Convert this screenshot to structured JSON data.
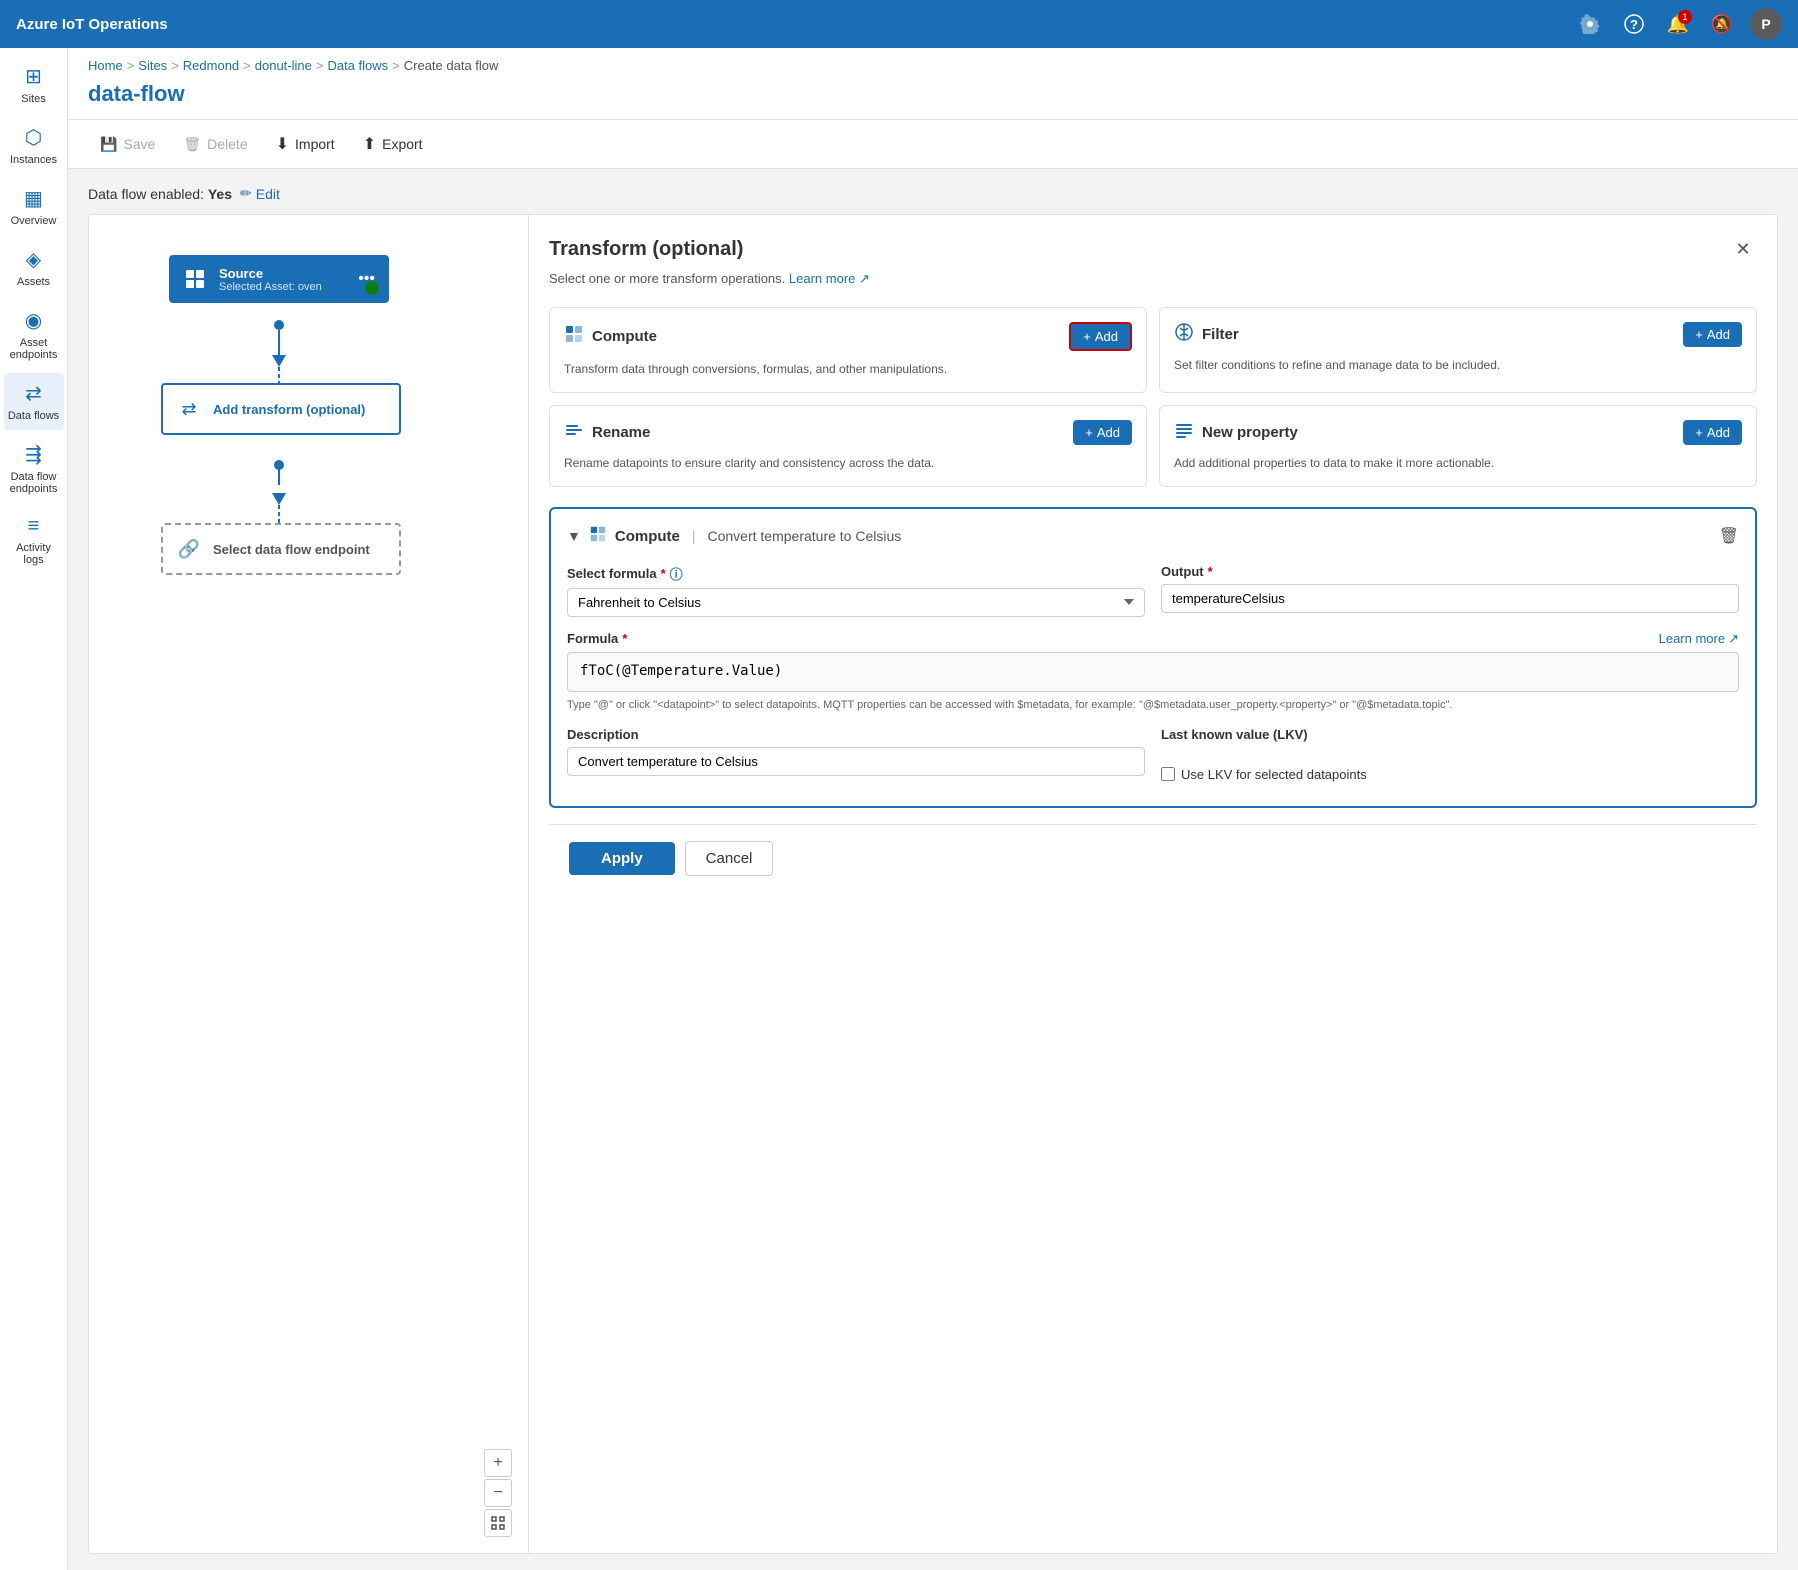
{
  "app": {
    "title": "Azure IoT Operations"
  },
  "topnav": {
    "settings_label": "Settings",
    "help_label": "Help",
    "notifications_label": "Notifications",
    "bell_label": "Bell",
    "notification_count": "1",
    "avatar_label": "P"
  },
  "sidebar": {
    "items": [
      {
        "id": "sites",
        "label": "Sites",
        "icon": "⊞"
      },
      {
        "id": "instances",
        "label": "Instances",
        "icon": "⬡"
      },
      {
        "id": "overview",
        "label": "Overview",
        "icon": "▦"
      },
      {
        "id": "assets",
        "label": "Assets",
        "icon": "◈"
      },
      {
        "id": "asset-endpoints",
        "label": "Asset endpoints",
        "icon": "◉"
      },
      {
        "id": "data-flows",
        "label": "Data flows",
        "icon": "⇄",
        "active": true
      },
      {
        "id": "data-flow-endpoints",
        "label": "Data flow endpoints",
        "icon": "⇶"
      },
      {
        "id": "activity-logs",
        "label": "Activity logs",
        "icon": "≡"
      }
    ]
  },
  "breadcrumb": {
    "items": [
      {
        "label": "Home",
        "link": true
      },
      {
        "label": "Sites",
        "link": true
      },
      {
        "label": "Redmond",
        "link": true
      },
      {
        "label": "donut-line",
        "link": true
      },
      {
        "label": "Data flows",
        "link": true
      },
      {
        "label": "Create data flow",
        "link": false
      }
    ]
  },
  "page": {
    "title": "data-flow",
    "enabled_label": "Data flow enabled:",
    "enabled_value": "Yes",
    "edit_label": "Edit"
  },
  "toolbar": {
    "save_label": "Save",
    "delete_label": "Delete",
    "import_label": "Import",
    "export_label": "Export"
  },
  "flow": {
    "source_node": {
      "title": "Source",
      "subtitle": "Selected Asset: oven"
    },
    "transform_node": {
      "title": "Add transform (optional)"
    },
    "endpoint_node": {
      "title": "Select data flow endpoint"
    }
  },
  "panel": {
    "title": "Transform (optional)",
    "subtitle": "Select one or more transform operations.",
    "learn_more": "Learn more",
    "cards": [
      {
        "id": "compute",
        "icon": "⚙",
        "title": "Compute",
        "desc": "Transform data through conversions, formulas, and other manipulations.",
        "add_label": "+ Add"
      },
      {
        "id": "filter",
        "icon": "⚗",
        "title": "Filter",
        "desc": "Set filter conditions to refine and manage data to be included.",
        "add_label": "+ Add"
      },
      {
        "id": "rename",
        "icon": "✎",
        "title": "Rename",
        "desc": "Rename datapoints to ensure clarity and consistency across the data.",
        "add_label": "+ Add"
      },
      {
        "id": "new-property",
        "icon": "☰",
        "title": "New property",
        "desc": "Add additional properties to data to make it more actionable.",
        "add_label": "+ Add"
      }
    ],
    "compute_section": {
      "title": "Compute",
      "separator": "|",
      "name": "Convert temperature to Celsius",
      "select_formula_label": "Select formula",
      "formula_value": "Fahrenheit to Celsius",
      "output_label": "Output",
      "output_value": "temperatureCelsius",
      "formula_label": "Formula",
      "formula_learn_more": "Learn more",
      "formula_code": "fToC(@Temperature.Value)",
      "formula_hint": "Type \"@\" or click \"<datapoint>\" to select datapoints. MQTT properties can be accessed with $metadata, for example: \"@$metadata.user_property.<property>\" or \"@$metadata.topic\".",
      "description_label": "Description",
      "description_value": "Convert temperature to Celsius",
      "lkv_label": "Last known value (LKV)",
      "lkv_checkbox_label": "Use LKV for selected datapoints"
    }
  },
  "bottom": {
    "apply_label": "Apply",
    "cancel_label": "Cancel"
  }
}
